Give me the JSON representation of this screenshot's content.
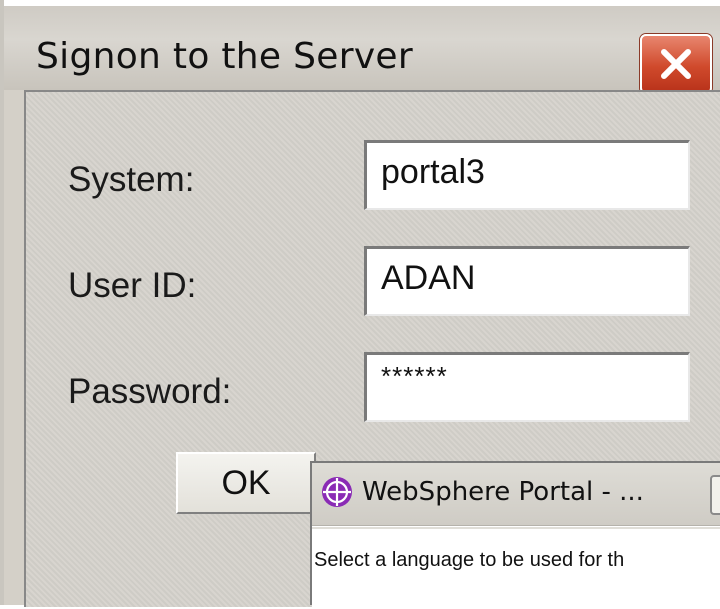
{
  "signon_dialog": {
    "title": "Signon to the Server",
    "close_icon": "close-x-icon",
    "fields": {
      "system": {
        "label": "System:",
        "value": "portal3"
      },
      "user_id": {
        "label": "User ID:",
        "value": "ADAN"
      },
      "password": {
        "label": "Password:",
        "value": "******"
      }
    },
    "ok_label": "OK"
  },
  "portal_dialog": {
    "title": "WebSphere Portal - ...",
    "icon": "websphere-globe-icon",
    "message": "Select a language to be used for th"
  },
  "colors": {
    "close_button": "#d04a2c",
    "dialog_face": "#d4d0c8",
    "portal_icon": "#8a2bb5"
  }
}
